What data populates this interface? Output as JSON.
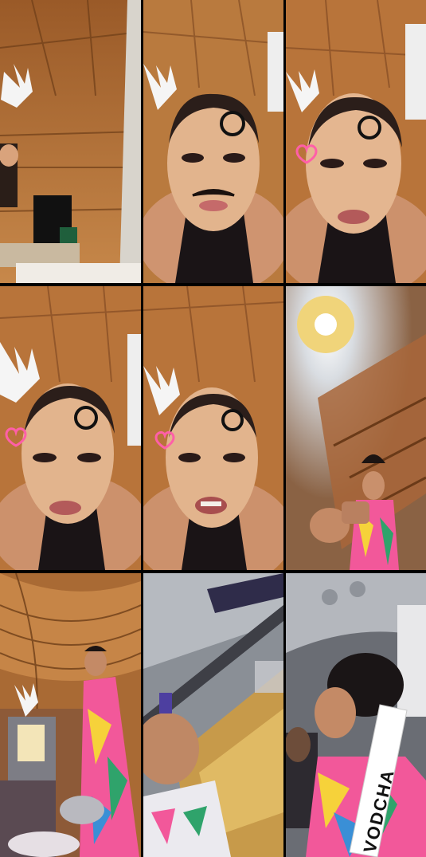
{
  "collage": {
    "rows": 3,
    "columns": 3,
    "background_color": "#000000",
    "tiles": [
      {
        "id": "wood-room-wide",
        "description_icon": "room-icon"
      },
      {
        "id": "face-filter-mustache",
        "description_icon": "face-icon"
      },
      {
        "id": "face-heart-sticker",
        "description_icon": "heart-icon"
      },
      {
        "id": "face-heart-sticker-2",
        "description_icon": "heart-icon"
      },
      {
        "id": "face-talking",
        "description_icon": "face-icon"
      },
      {
        "id": "ceiling-light-dress",
        "description_icon": "lamp-icon"
      },
      {
        "id": "fisheye-room-dress",
        "description_icon": "room-icon"
      },
      {
        "id": "blurry-bus-window",
        "description_icon": "window-icon"
      },
      {
        "id": "bus-sash",
        "description_icon": "sash-icon"
      }
    ]
  },
  "sash_text": "VODCHA",
  "colors": {
    "wood": "#b8743a",
    "wood_dark": "#7a4520",
    "skin": "#e0b08c",
    "top_black": "#1a1416",
    "heart_pink": "#ff5fa8",
    "dress_pink": "#f2589a",
    "dress_yellow": "#f6d23a",
    "dress_green": "#2fa36b"
  }
}
